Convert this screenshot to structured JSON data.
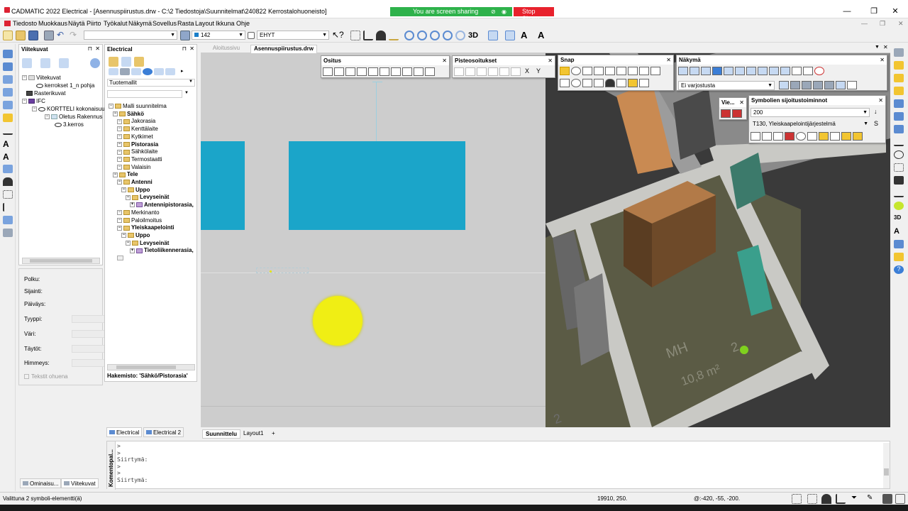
{
  "window": {
    "title": "CADMATIC 2022 Electrical - [Asennuspiirustus.drw - C:\\2 Tiedostoja\\Suunnitelmat\\240822 Kerrostalohuoneisto]",
    "share_text": "You are screen sharing",
    "stop_share": "Stop Share",
    "min": "—",
    "restore": "❐",
    "close": "✕"
  },
  "menu": [
    "Tiedosto",
    "Muokkaus",
    "Näytä",
    "Piirto",
    "Työkalut",
    "Näkymä",
    "Sovellus",
    "Rasta",
    "Layout",
    "Ikkuna",
    "Ohje"
  ],
  "toolbar": {
    "layer_value": "142",
    "line_value": "EHYT",
    "view3d_label": "3D"
  },
  "viitekuvat": {
    "title": "Viitekuvat",
    "tree": [
      {
        "label": "Viitekuvat",
        "level": 0
      },
      {
        "label": "kerrokset 1_n pohja",
        "level": 1
      },
      {
        "label": "Rasterikuvat",
        "level": 0
      },
      {
        "label": "IFC",
        "level": 0
      },
      {
        "label": "KORTTELI kokonaisuus",
        "level": 1
      },
      {
        "label": "Oletus Rakennus",
        "level": 2
      },
      {
        "label": "3.kerros",
        "level": 3
      }
    ],
    "props": {
      "polku": "Polku:",
      "sijainti": "Sijainti:",
      "paivays": "Päiväys:",
      "tyyppi": "Tyyppi:",
      "vari": "Väri:",
      "taytot": "Täytöt:",
      "himmeys": "Himmeys:",
      "tekstit": "Tekstit ohuena"
    },
    "tabs": [
      "Ominaisu...",
      "Viitekuvat"
    ]
  },
  "electrical": {
    "title": "Electrical",
    "filter": "Tuotemallit",
    "tree": [
      {
        "label": "Malli suunnitelma",
        "indent": 0,
        "bold": false
      },
      {
        "label": "Sähkö",
        "indent": 1,
        "bold": true
      },
      {
        "label": "Jakorasia",
        "indent": 2,
        "bold": false
      },
      {
        "label": "Kenttälaite",
        "indent": 2,
        "bold": false
      },
      {
        "label": "Kytkimet",
        "indent": 2,
        "bold": false
      },
      {
        "label": "Pistorasia",
        "indent": 2,
        "bold": true
      },
      {
        "label": "Sähkölaite",
        "indent": 2,
        "bold": false
      },
      {
        "label": "Termostaatti",
        "indent": 2,
        "bold": false
      },
      {
        "label": "Valaisin",
        "indent": 2,
        "bold": false
      },
      {
        "label": "Tele",
        "indent": 1,
        "bold": true
      },
      {
        "label": "Antenni",
        "indent": 2,
        "bold": true
      },
      {
        "label": "Uppo",
        "indent": 3,
        "bold": true
      },
      {
        "label": "Levyseinät",
        "indent": 4,
        "bold": true
      },
      {
        "label": "Antennipistorasia, PL",
        "indent": 5,
        "bold": true
      },
      {
        "label": "Merkinanto",
        "indent": 2,
        "bold": false
      },
      {
        "label": "Paloilmoitus",
        "indent": 2,
        "bold": false
      },
      {
        "label": "Yleiskaapelointi",
        "indent": 2,
        "bold": true
      },
      {
        "label": "Uppo",
        "indent": 3,
        "bold": true
      },
      {
        "label": "Levyseinät",
        "indent": 4,
        "bold": true
      },
      {
        "label": "Tietoliikennerasia, PI",
        "indent": 5,
        "bold": true
      }
    ],
    "hakemisto": "Hakemisto: 'Sähkö/Pistorasia'",
    "tabs": [
      "Electrical",
      "Electrical 2"
    ]
  },
  "doc_tabs": [
    "Aloitussivu",
    "Asennuspiirustus.drw"
  ],
  "layout_tabs": [
    "Suunnittelu",
    "Layout1",
    "+"
  ],
  "floating": {
    "ositus": "Ositus",
    "pisteosoitukset": "Pisteosoitukset",
    "snap": "Snap",
    "nakyma": "Näkymä",
    "nakyma_combo": "Ei varjostusta",
    "vie": "Vie...",
    "symbolien": "Symbolien sijoitustoiminnot",
    "sym_value": "200",
    "sym_system": "T130, Yleiskaapelointijärjestelmä",
    "xy_x": "X",
    "xy_y": "Y"
  },
  "view3d_labels": {
    "mh": "MH",
    "area": "10,8 m²",
    "num": "2"
  },
  "command": {
    "side_label": "Komentopal...",
    "lines": [
      ">",
      ">",
      "Siirtymä:",
      ">",
      ">",
      "Siirtymä:"
    ]
  },
  "status": {
    "left": "Valittuna 2 symboli-elementti(ä)",
    "coords": "19910, 250.",
    "coords2": "@:-420, -55, -200."
  }
}
